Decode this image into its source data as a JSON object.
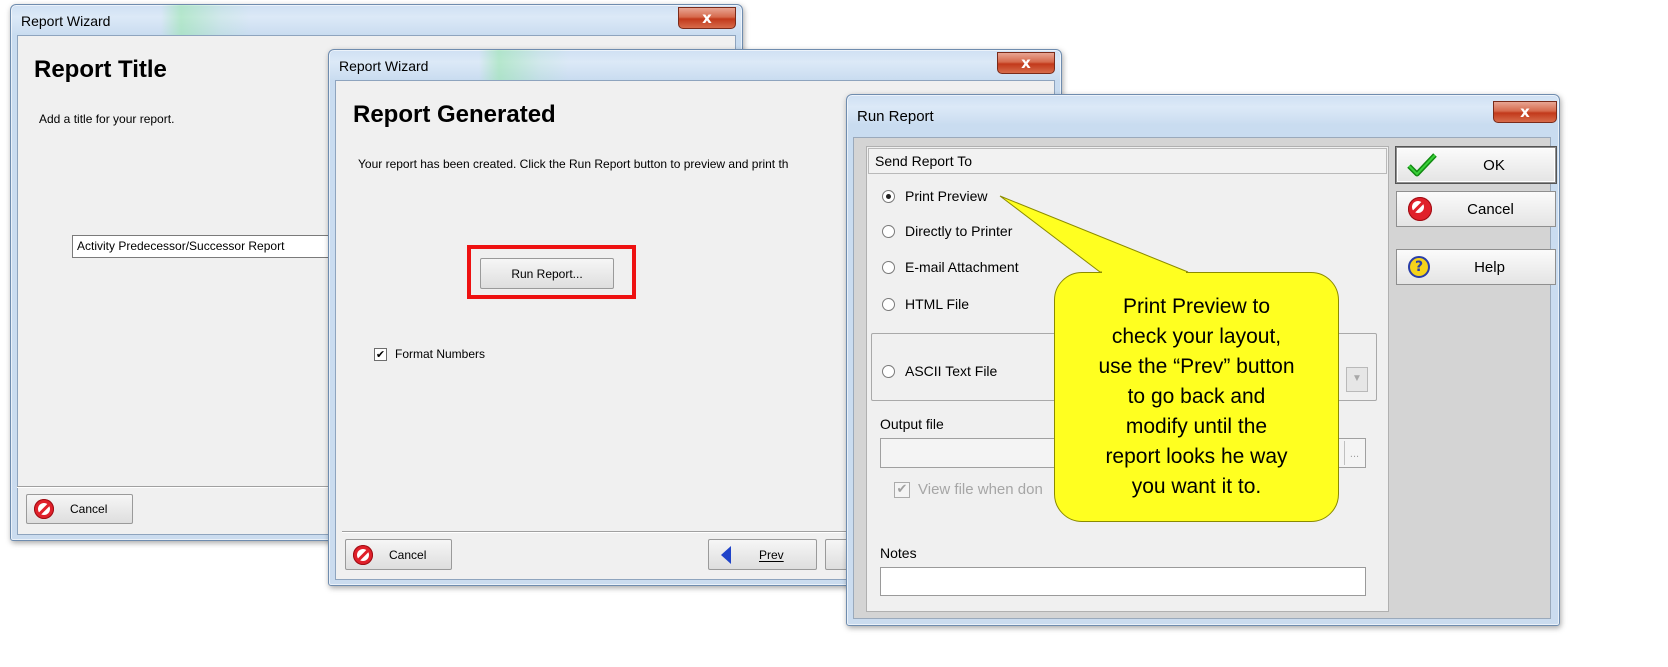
{
  "wizard_back": {
    "title": "Report Wizard",
    "close_label": "x",
    "heading": "Report Title",
    "instruction": "Add a title for your report.",
    "title_value": "Activity Predecessor/Successor Report",
    "cancel_label": "Cancel"
  },
  "wizard_front": {
    "title": "Report Wizard",
    "close_label": "x",
    "heading": "Report Generated",
    "instruction": "Your report has been created.  Click the Run Report button to preview and print th",
    "run_report_label": "Run Report...",
    "format_numbers_label": "Format Numbers",
    "format_numbers_checked": true,
    "cancel_label": "Cancel",
    "prev_label": "Prev",
    "highlight_color": "#ee1111"
  },
  "run_report": {
    "title": "Run Report",
    "close_label": "x",
    "send_group_label": "Send Report To",
    "options": [
      {
        "label": "Print Preview",
        "selected": true
      },
      {
        "label": "Directly to Printer",
        "selected": false
      },
      {
        "label": "E-mail Attachment",
        "selected": false
      },
      {
        "label": "HTML File",
        "selected": false
      },
      {
        "label": "ASCII Text File",
        "selected": false
      }
    ],
    "output_file_label": "Output file",
    "output_file_value": "",
    "view_file_label": "View file when don",
    "view_file_checked": true,
    "notes_label": "Notes",
    "notes_value": "",
    "ok_label": "OK",
    "cancel_label": "Cancel",
    "help_label": "Help"
  },
  "callout": {
    "text": "Print Preview to\ncheck your layout,\nuse the “Prev” button\nto go back and\nmodify until the\nreport looks he way\nyou want it to.",
    "fill_color": "#ffff20"
  }
}
